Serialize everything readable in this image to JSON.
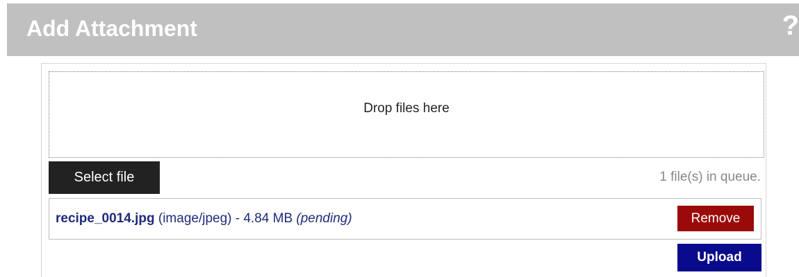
{
  "dialog": {
    "title": "Add Attachment",
    "help_label": "?"
  },
  "dropzone": {
    "text": "Drop files here"
  },
  "queue": {
    "select_label": "Select file",
    "count_text": "1 file(s) in queue.",
    "files": [
      {
        "name": "recipe_0014.jpg",
        "details": " (image/jpeg) - 4.84 MB ",
        "status": "(pending)",
        "remove_label": "Remove"
      }
    ]
  },
  "actions": {
    "upload_label": "Upload"
  },
  "colors": {
    "titlebar": "#c0c0c0",
    "select_button": "#222222",
    "remove_button": "#9b0a0a",
    "upload_button": "#0a0a8c",
    "file_text": "#1f2a7a"
  },
  "icons": {
    "help": "help-icon"
  }
}
